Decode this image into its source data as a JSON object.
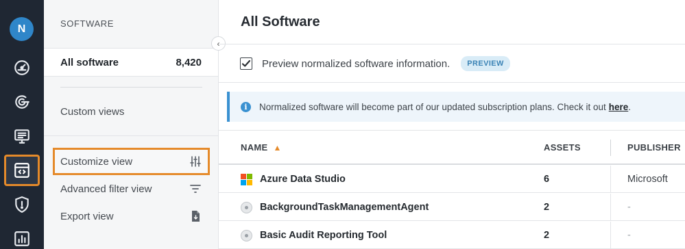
{
  "colors": {
    "rail_bg": "#1f2733",
    "accent_orange": "#e58a2a",
    "avatar_blue": "#2f86c9",
    "info_blue": "#3a91d1"
  },
  "user": {
    "avatar_initial": "N"
  },
  "rail": {
    "items": [
      {
        "icon": "dashboard-icon",
        "active": false
      },
      {
        "icon": "scan-icon",
        "active": false
      },
      {
        "icon": "monitor-list-icon",
        "active": false
      },
      {
        "icon": "software-code-icon",
        "active": true
      },
      {
        "icon": "shield-alert-icon",
        "active": false
      },
      {
        "icon": "report-chart-icon",
        "active": false
      }
    ]
  },
  "subnav": {
    "heading": "SOFTWARE",
    "all_label": "All software",
    "all_count": "8,420",
    "custom_views_label": "Custom views",
    "actions": [
      {
        "label": "Customize view",
        "icon": "sliders-icon",
        "highlighted": true
      },
      {
        "label": "Advanced filter view",
        "icon": "filter-icon",
        "highlighted": false
      },
      {
        "label": "Export view",
        "icon": "export-file-icon",
        "highlighted": false
      }
    ]
  },
  "main": {
    "title": "All Software",
    "preview": {
      "checked": true,
      "label": "Preview normalized software information.",
      "badge": "PREVIEW"
    },
    "notice": {
      "text": "Normalized software will become part of our updated subscription plans. Check it out",
      "link": "here",
      "suffix": "."
    },
    "table": {
      "columns": [
        "NAME",
        "ASSETS",
        "PUBLISHER"
      ],
      "sorted_column": "NAME",
      "sort_direction": "ascending",
      "rows": [
        {
          "icon": "microsoft-logo-icon",
          "name": "Azure Data Studio",
          "assets": "6",
          "publisher": "Microsoft"
        },
        {
          "icon": "generic-disc-icon",
          "name": "BackgroundTaskManagementAgent",
          "assets": "2",
          "publisher": "-"
        },
        {
          "icon": "generic-disc-icon",
          "name": "Basic Audit Reporting Tool",
          "assets": "2",
          "publisher": "-"
        }
      ]
    }
  }
}
